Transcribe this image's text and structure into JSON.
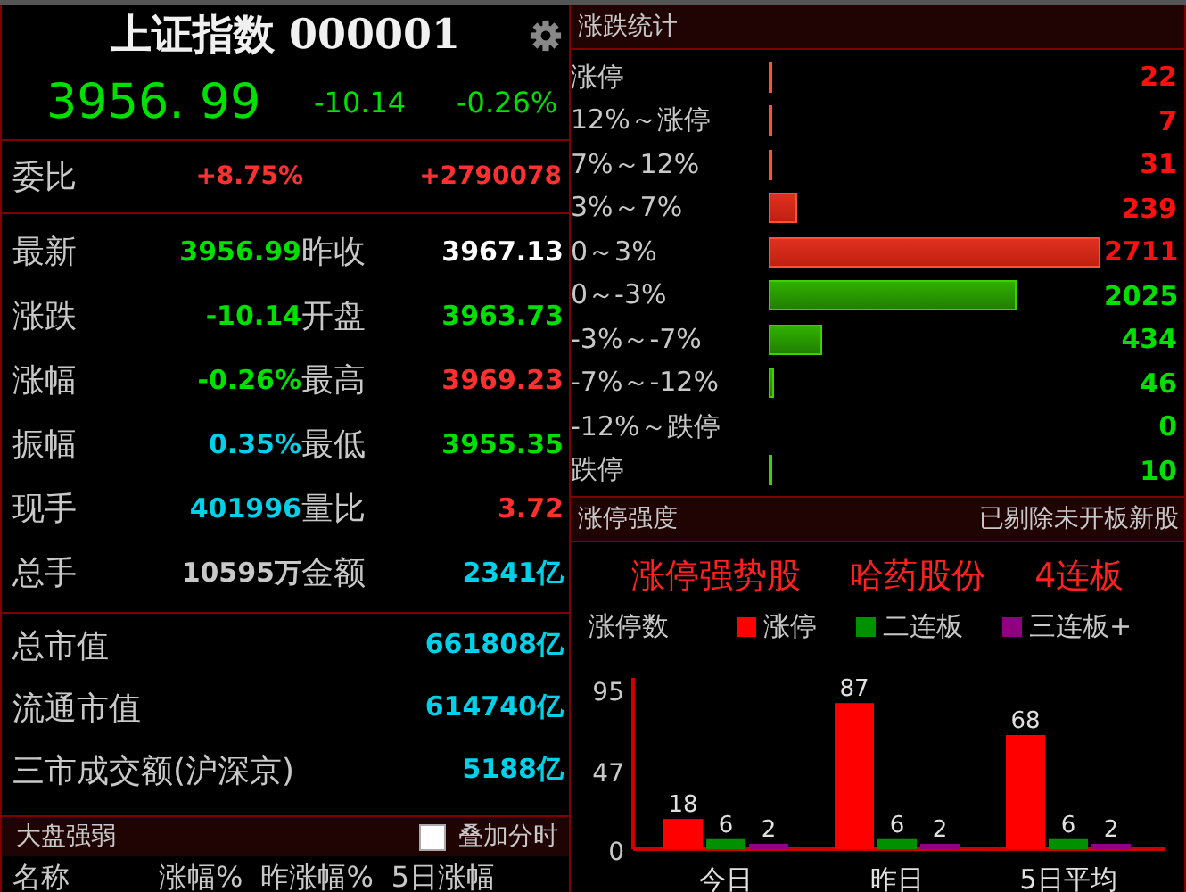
{
  "quote": {
    "title": "上证指数 000001",
    "figures": [
      {
        "value": "3956. 99",
        "color": "#00e000"
      },
      {
        "value": "-10.14",
        "color": "#00e000"
      },
      {
        "value": "-0.26%",
        "color": "#00e000"
      }
    ]
  },
  "order_ratio": {
    "label": "委比",
    "values": [
      {
        "value": "+8.75%",
        "color": "#ff3030"
      },
      {
        "value": "+2790078",
        "color": "#ff3030"
      }
    ]
  },
  "stats": [
    {
      "label": "最新",
      "value": "3956.99",
      "color": "#00e000"
    },
    {
      "label": "昨收",
      "value": "3967.13",
      "color": "#ffffff"
    },
    {
      "label": "涨跌",
      "value": "-10.14",
      "color": "#00e000"
    },
    {
      "label": "开盘",
      "value": "3963.73",
      "color": "#00e000"
    },
    {
      "label": "涨幅",
      "value": "-0.26%",
      "color": "#00e000"
    },
    {
      "label": "最高",
      "value": "3969.23",
      "color": "#ff3030"
    },
    {
      "label": "振幅",
      "value": "0.35%",
      "color": "#00d0e8"
    },
    {
      "label": "最低",
      "value": "3955.35",
      "color": "#00e000"
    },
    {
      "label": "现手",
      "value": "401996",
      "color": "#00d0e8"
    },
    {
      "label": "量比",
      "value": "3.72",
      "color": "#ff3030"
    },
    {
      "label": "总手",
      "value": "10595万",
      "color": "#c8c8c8"
    },
    {
      "label": "金额",
      "value": "2341亿",
      "color": "#00d0e8"
    }
  ],
  "market": [
    {
      "label": "总市值",
      "value": "661808亿"
    },
    {
      "label": "流通市值",
      "value": "614740亿"
    },
    {
      "label": "三市成交额(沪深京)",
      "value": "5188亿"
    }
  ],
  "strength": {
    "title": "大盘强弱",
    "overlay_label": "叠加分时",
    "overlay_checked": false,
    "columns": [
      "名称",
      "涨幅%",
      "昨涨幅%",
      "5日涨幅"
    ]
  },
  "distribution": {
    "title": "涨跌统计",
    "rows": [
      {
        "label": "涨停",
        "count": "22",
        "kind": "rise"
      },
      {
        "label": "12%～涨停",
        "count": "7",
        "kind": "rise"
      },
      {
        "label": "7%～12%",
        "count": "31",
        "kind": "rise"
      },
      {
        "label": "3%～7%",
        "count": "239",
        "kind": "rise"
      },
      {
        "label": "0～3%",
        "count": "2711",
        "kind": "rise"
      },
      {
        "label": "0～-3%",
        "count": "2025",
        "kind": "fall"
      },
      {
        "label": "-3%～-7%",
        "count": "434",
        "kind": "fall"
      },
      {
        "label": "-7%～-12%",
        "count": "46",
        "kind": "fall"
      },
      {
        "label": "-12%～跌停",
        "count": "0",
        "kind": "fall"
      },
      {
        "label": "跌停",
        "count": "10",
        "kind": "fall"
      }
    ]
  },
  "limit_up": {
    "title": "涨停强度",
    "note": "已剔除未开板新股",
    "highlights": [
      "涨停强势股",
      "哈药股份",
      "4连板"
    ],
    "chart_data": {
      "type": "bar",
      "ylabel": "涨停数",
      "categories": [
        "今日",
        "昨日",
        "5日平均"
      ],
      "ylim": [
        0,
        102
      ],
      "yticks": [
        0,
        47,
        95
      ],
      "data_labels": true,
      "series": [
        {
          "name": "涨停",
          "color": "#ff0000",
          "values": [
            18,
            87,
            68
          ]
        },
        {
          "name": "二连板",
          "color": "#009000",
          "values": [
            6,
            6,
            6
          ]
        },
        {
          "name": "三连板+",
          "color": "#900080",
          "values": [
            2,
            2,
            2
          ]
        }
      ]
    }
  }
}
